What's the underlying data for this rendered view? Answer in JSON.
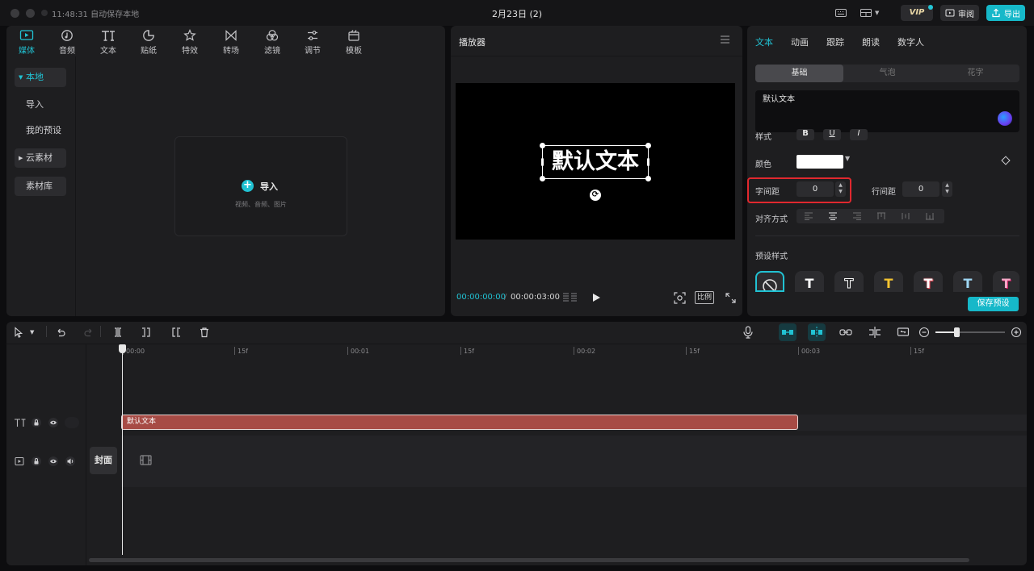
{
  "titlebar": {
    "save_status": "11:48:31 自动保存本地",
    "project_title": "2月23日 (2)",
    "vip_label": "VIP",
    "review_label": "审阅",
    "export_label": "导出"
  },
  "media": {
    "tabs": [
      {
        "label": "媒体",
        "icon": "media-icon"
      },
      {
        "label": "音频",
        "icon": "audio-icon"
      },
      {
        "label": "文本",
        "icon": "text-icon"
      },
      {
        "label": "贴纸",
        "icon": "sticker-icon"
      },
      {
        "label": "特效",
        "icon": "effects-icon"
      },
      {
        "label": "转场",
        "icon": "transition-icon"
      },
      {
        "label": "滤镜",
        "icon": "filter-icon"
      },
      {
        "label": "调节",
        "icon": "adjust-icon"
      },
      {
        "label": "模板",
        "icon": "template-icon"
      }
    ],
    "sidebar": {
      "local": "本地",
      "import": "导入",
      "my_presets": "我的预设",
      "cloud": "云素材",
      "library": "素材库"
    },
    "import_label": "导入",
    "import_hint": "视频、音频、图片"
  },
  "player": {
    "title": "播放器",
    "canvas_text": "默认文本",
    "time_current": "00:00:00:00",
    "time_total": "00:00:03:00",
    "ratio_label": "比例"
  },
  "properties": {
    "tabs": [
      "文本",
      "动画",
      "跟踪",
      "朗读",
      "数字人"
    ],
    "segments": [
      "基础",
      "气泡",
      "花字"
    ],
    "text_value": "默认文本",
    "style_label": "样式",
    "bold": "B",
    "underline": "U",
    "italic": "I",
    "color_label": "颜色",
    "letter_spacing_label": "字间距",
    "letter_spacing_value": "0",
    "line_spacing_label": "行间距",
    "line_spacing_value": "0",
    "align_label": "对齐方式",
    "preset_label": "预设样式",
    "save_preset": "保存预设",
    "color_value": "#ffffff",
    "accent": "#21c2d3"
  },
  "timeline": {
    "ruler": [
      "00:00",
      "15f",
      "00:01",
      "15f",
      "00:02",
      "15f",
      "00:03",
      "15f"
    ],
    "text_clip_label": "默认文本",
    "cover_label": "封面"
  }
}
